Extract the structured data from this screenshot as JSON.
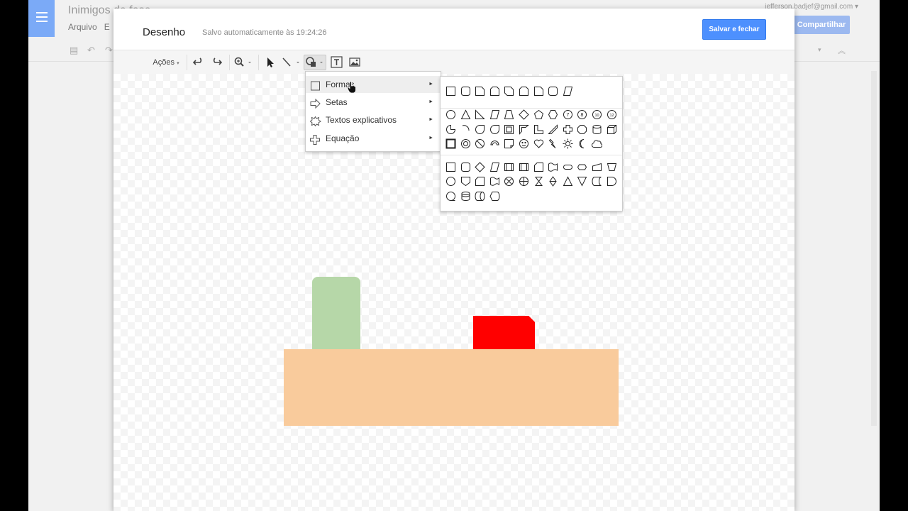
{
  "docs": {
    "title": "Inimigos de fase",
    "menu": [
      "Arquivo",
      "E"
    ],
    "account_email": "jefferson.badjef@gmail.com",
    "share_label": "Compartilhar"
  },
  "dialog": {
    "title": "Desenho",
    "autosave_status": "Salvo automaticamente às 19:24:26",
    "save_button": "Salvar e fechar"
  },
  "toolbar": {
    "actions_label": "Ações",
    "tools": [
      "undo-icon",
      "redo-icon",
      "zoom-icon",
      "select-icon",
      "line-icon",
      "shape-icon",
      "text-box-icon",
      "image-icon"
    ]
  },
  "insert_menu": {
    "items": [
      {
        "label": "Formas",
        "icon": "square-icon",
        "highlighted": true
      },
      {
        "label": "Setas",
        "icon": "arrow-icon",
        "highlighted": false
      },
      {
        "label": "Textos explicativos",
        "icon": "callout-icon",
        "highlighted": false
      },
      {
        "label": "Equação",
        "icon": "plus-icon",
        "highlighted": false
      }
    ]
  },
  "shapes_submenu": {
    "groups": [
      "rectangles",
      "basic-shapes",
      "flowchart"
    ]
  },
  "canvas": {
    "shapes": [
      {
        "name": "green-rounded-rectangle",
        "color": "#b6d7a8"
      },
      {
        "name": "red-snipped-rectangle",
        "color": "#ff0000"
      },
      {
        "name": "orange-rectangle",
        "color": "#f9cb9c"
      }
    ]
  },
  "colors": {
    "primary_button": "#4d90fe",
    "menu_highlight": "#eeeeee"
  }
}
